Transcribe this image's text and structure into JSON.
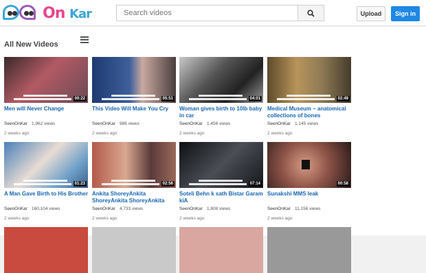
{
  "header": {
    "logo_text_1": "On",
    "logo_text_2": "Kar",
    "search_placeholder": "Search videos",
    "upload_label": "Upload",
    "signin_label": "Sign in"
  },
  "section": {
    "title": "All New Videos"
  },
  "videos": [
    {
      "title": "Men will Never Change",
      "channel": "SeenOnKar",
      "views": "1,962 views",
      "age": "2 weeks ago",
      "duration": "00:22"
    },
    {
      "title": "This Video Will Make You Cry",
      "channel": "SeenOnKar",
      "views": "986 views",
      "age": "2 weeks ago",
      "duration": "05:51"
    },
    {
      "title": "Woman gives birth to 10lb baby in car",
      "channel": "SeenOnKar",
      "views": "1,456 views",
      "age": "2 weeks ago",
      "duration": "04:01"
    },
    {
      "title": "Medical Museum – anatomical collections of bones",
      "channel": "SeenOnKar",
      "views": "1,145 views",
      "age": "2 weeks ago",
      "duration": "02:49"
    },
    {
      "title": "A Man Gave Birth to His Brother",
      "channel": "SeenOnKar",
      "views": "160,104 views",
      "age": "2 weeks ago",
      "duration": "01:23"
    },
    {
      "title": "Ankita ShoreyAnkita ShoreyAnkita ShoreyAnkita",
      "channel": "SeenOnKar",
      "views": "4,733 views",
      "age": "2 weeks ago",
      "duration": "02:56"
    },
    {
      "title": "Soteli Behn k sath Bistar Garam kiA",
      "channel": "SeenOnKar",
      "views": "1,808 views",
      "age": "2 weeks ago",
      "duration": "07:14"
    },
    {
      "title": "Sunakshi MMS leak",
      "channel": "SeenOnKar",
      "views": "11,156 views",
      "age": "2 weeks ago",
      "duration": "00:58"
    }
  ]
}
